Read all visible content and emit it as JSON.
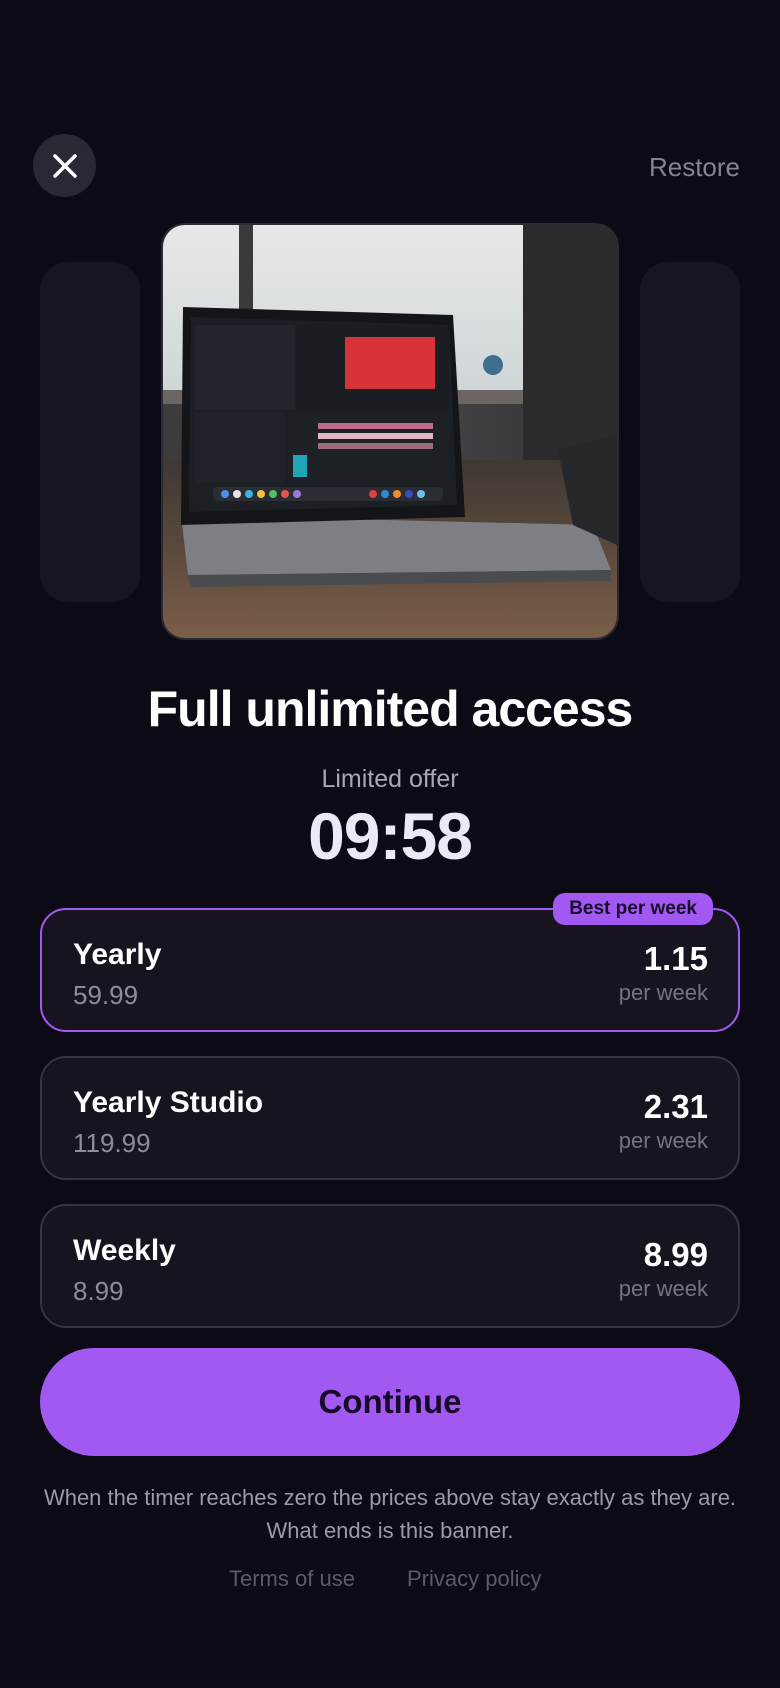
{
  "header": {
    "close_icon": "close-icon",
    "restore_label": "Restore"
  },
  "hero": {
    "image_subject": "laptop on desk running video editing software"
  },
  "title": "Full unlimited access",
  "offer": {
    "label": "Limited offer",
    "timer": "09:58"
  },
  "plans": [
    {
      "name": "Yearly",
      "total": "59.99",
      "price": "1.15",
      "unit": "per week",
      "badge": "Best per week",
      "selected": true
    },
    {
      "name": "Yearly Studio",
      "total": "119.99",
      "price": "2.31",
      "unit": "per week",
      "badge": "",
      "selected": false
    },
    {
      "name": "Weekly",
      "total": "8.99",
      "price": "8.99",
      "unit": "per week",
      "badge": "",
      "selected": false
    }
  ],
  "continue_label": "Continue",
  "disclaimer": "When the timer reaches zero the prices above stay exactly as they are. What ends is this banner.",
  "footer": {
    "terms_label": "Terms of use",
    "privacy_label": "Privacy policy"
  },
  "colors": {
    "background": "#0c0a15",
    "accent": "#a259f2",
    "card": "#17141f",
    "card_border": "#37343f"
  }
}
